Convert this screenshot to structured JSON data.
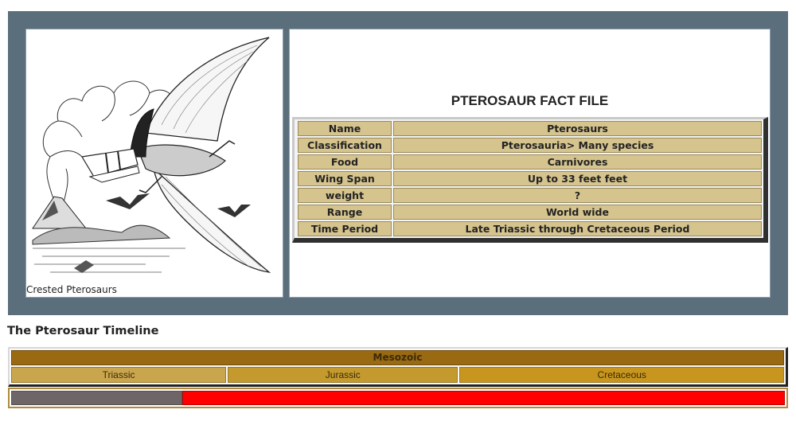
{
  "illustration": {
    "caption": "Crested Pterosaurs",
    "icon": "pterosaur-illustration"
  },
  "fact_file": {
    "title": "PTEROSAUR FACT FILE",
    "rows": [
      {
        "key": "Name",
        "value": "Pterosaurs"
      },
      {
        "key": "Classification",
        "value": "Pterosauria> Many species"
      },
      {
        "key": "Food",
        "value": "Carnivores"
      },
      {
        "key": "Wing Span",
        "value": "Up to 33 feet feet"
      },
      {
        "key": "weight",
        "value": "?"
      },
      {
        "key": "Range",
        "value": "World wide"
      },
      {
        "key": "Time Period",
        "value": "Late Triassic through Cretaceous Period"
      }
    ]
  },
  "timeline": {
    "heading": "The Pterosaur Timeline",
    "era": "Mesozoic",
    "periods": [
      {
        "name": "Triassic",
        "share": 0.279,
        "color": "#c9a64e"
      },
      {
        "name": "Jurassic",
        "share": 0.299,
        "color": "#c49a2e"
      },
      {
        "name": "Cretaceous",
        "share": 0.422,
        "color": "#c8961e"
      }
    ],
    "range": {
      "start_fraction": 0.22,
      "absent_color": "#6e6566",
      "present_color": "#ff0000"
    }
  },
  "colors": {
    "frame": "#5b6e7c",
    "fact_cell": "#d6c48e",
    "era_main": "#9a6a12"
  }
}
